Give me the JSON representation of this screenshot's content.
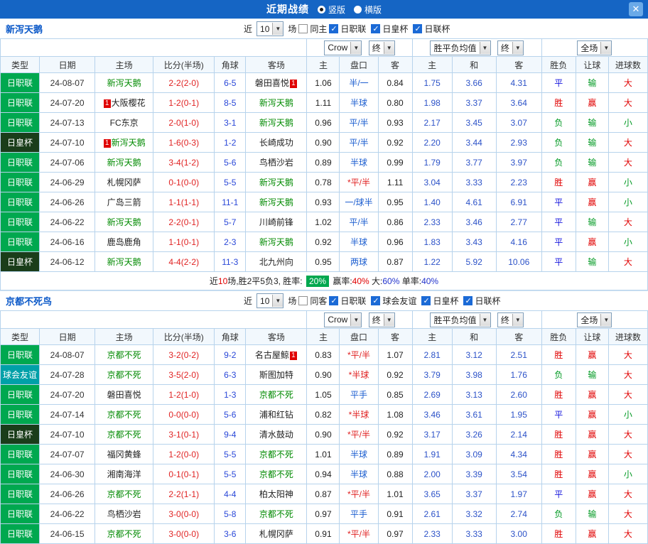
{
  "title_bar": {
    "title": "近期战绩",
    "vertical": "竖版",
    "horizontal": "横版",
    "close": "✕"
  },
  "labels": {
    "near": "近",
    "games": "场",
    "badge": "1"
  },
  "selects": {
    "company": "Crow",
    "final": "终",
    "avg": "胜平负均值",
    "full": "全场"
  },
  "cols": [
    "类型",
    "日期",
    "主场",
    "比分(半场)",
    "角球",
    "客场",
    "主",
    "盘口",
    "客",
    "主",
    "和",
    "客",
    "胜负",
    "让球",
    "进球数"
  ],
  "type_colors": {
    "日职联": "#00a84f",
    "日皇杯": "#1a3d1a",
    "球会友谊": "#00a0a8"
  },
  "colors": {
    "titlebar": "#1565c4",
    "grid_border": "#b7d3ec",
    "focus_team": "#018a01",
    "score_red": "#e02222",
    "odds_blue": "#2c52c8",
    "win_red": "#e00000",
    "lose_green": "#009922",
    "draw_blue": "#1515dd"
  },
  "sections": [
    {
      "team": "新泻天鹅",
      "count": "10",
      "same": "同主",
      "leagues": [
        "日职联",
        "日皇杯",
        "日联杯"
      ],
      "rows": [
        {
          "type": "日职联",
          "date": "24-08-07",
          "home": "新泻天鹅",
          "hf": true,
          "hb": "",
          "away": "磐田喜悦",
          "af": false,
          "ab": "after",
          "score": "2-2(2-0)",
          "corner": "6-5",
          "ah": [
            "1.06",
            "半/一",
            "0.84"
          ],
          "odds": [
            "1.75",
            "3.66",
            "4.31"
          ],
          "res": "平",
          "lt": "输",
          "sz": "大"
        },
        {
          "type": "日职联",
          "date": "24-07-20",
          "home": "大阪樱花",
          "hf": false,
          "hb": "before",
          "away": "新泻天鹅",
          "af": true,
          "ab": "",
          "score": "1-2(0-1)",
          "corner": "8-5",
          "ah": [
            "1.11",
            "半球",
            "0.80"
          ],
          "odds": [
            "1.98",
            "3.37",
            "3.64"
          ],
          "res": "胜",
          "lt": "赢",
          "sz": "大"
        },
        {
          "type": "日职联",
          "date": "24-07-13",
          "home": "FC东京",
          "hf": false,
          "hb": "",
          "away": "新泻天鹅",
          "af": true,
          "ab": "",
          "score": "2-0(1-0)",
          "corner": "3-1",
          "ah": [
            "0.96",
            "平/半",
            "0.93"
          ],
          "odds": [
            "2.17",
            "3.45",
            "3.07"
          ],
          "res": "负",
          "lt": "输",
          "sz": "小"
        },
        {
          "type": "日皇杯",
          "date": "24-07-10",
          "home": "新泻天鹅",
          "hf": true,
          "hb": "before",
          "away": "长崎成功",
          "af": false,
          "ab": "",
          "score": "1-6(0-3)",
          "corner": "1-2",
          "ah": [
            "0.90",
            "平/半",
            "0.92"
          ],
          "odds": [
            "2.20",
            "3.44",
            "2.93"
          ],
          "res": "负",
          "lt": "输",
          "sz": "大"
        },
        {
          "type": "日职联",
          "date": "24-07-06",
          "home": "新泻天鹅",
          "hf": true,
          "hb": "",
          "away": "鸟栖沙岩",
          "af": false,
          "ab": "",
          "score": "3-4(1-2)",
          "corner": "5-6",
          "ah": [
            "0.89",
            "半球",
            "0.99"
          ],
          "odds": [
            "1.79",
            "3.77",
            "3.97"
          ],
          "res": "负",
          "lt": "输",
          "sz": "大"
        },
        {
          "type": "日职联",
          "date": "24-06-29",
          "home": "札幌冈萨",
          "hf": false,
          "hb": "",
          "away": "新泻天鹅",
          "af": true,
          "ab": "",
          "score": "0-1(0-0)",
          "corner": "5-5",
          "ah": [
            "0.78",
            "*平/半",
            "1.11"
          ],
          "odds": [
            "3.04",
            "3.33",
            "2.23"
          ],
          "res": "胜",
          "lt": "赢",
          "sz": "小"
        },
        {
          "type": "日职联",
          "date": "24-06-26",
          "home": "广岛三箭",
          "hf": false,
          "hb": "",
          "away": "新泻天鹅",
          "af": true,
          "ab": "",
          "score": "1-1(1-1)",
          "corner": "11-1",
          "ah": [
            "0.93",
            "一/球半",
            "0.95"
          ],
          "odds": [
            "1.40",
            "4.61",
            "6.91"
          ],
          "res": "平",
          "lt": "赢",
          "sz": "小"
        },
        {
          "type": "日职联",
          "date": "24-06-22",
          "home": "新泻天鹅",
          "hf": true,
          "hb": "",
          "away": "川崎前锋",
          "af": false,
          "ab": "",
          "score": "2-2(0-1)",
          "corner": "5-7",
          "ah": [
            "1.02",
            "平/半",
            "0.86"
          ],
          "odds": [
            "2.33",
            "3.46",
            "2.77"
          ],
          "res": "平",
          "lt": "输",
          "sz": "大"
        },
        {
          "type": "日职联",
          "date": "24-06-16",
          "home": "鹿岛鹿角",
          "hf": false,
          "hb": "",
          "away": "新泻天鹅",
          "af": true,
          "ab": "",
          "score": "1-1(0-1)",
          "corner": "2-3",
          "ah": [
            "0.92",
            "半球",
            "0.96"
          ],
          "odds": [
            "1.83",
            "3.43",
            "4.16"
          ],
          "res": "平",
          "lt": "赢",
          "sz": "小"
        },
        {
          "type": "日皇杯",
          "date": "24-06-12",
          "home": "新泻天鹅",
          "hf": true,
          "hb": "",
          "away": "北九州向",
          "af": false,
          "ab": "",
          "score": "4-4(2-2)",
          "corner": "11-3",
          "ah": [
            "0.95",
            "两球",
            "0.87"
          ],
          "odds": [
            "1.22",
            "5.92",
            "10.06"
          ],
          "res": "平",
          "lt": "输",
          "sz": "大"
        }
      ],
      "summary": [
        {
          "text": "近"
        },
        {
          "text": "10",
          "cls": "sum-red"
        },
        {
          "text": "场,胜2平5负3, 胜率: "
        },
        {
          "text": "20%",
          "cls": "badge-green"
        },
        {
          "text": " 赢率:"
        },
        {
          "text": "40%",
          "cls": "sum-red"
        },
        {
          "text": " 大:"
        },
        {
          "text": "60%",
          "cls": "sum-blue"
        },
        {
          "text": " 单率:"
        },
        {
          "text": "40%",
          "cls": "sum-blue"
        }
      ]
    },
    {
      "team": "京都不死鸟",
      "count": "10",
      "same": "同客",
      "leagues": [
        "日职联",
        "球会友谊",
        "日皇杯",
        "日联杯"
      ],
      "rows": [
        {
          "type": "日职联",
          "date": "24-08-07",
          "home": "京都不死",
          "hf": true,
          "hb": "",
          "away": "名古屋鲸",
          "af": false,
          "ab": "after",
          "score": "3-2(0-2)",
          "corner": "9-2",
          "ah": [
            "0.83",
            "*平/半",
            "1.07"
          ],
          "odds": [
            "2.81",
            "3.12",
            "2.51"
          ],
          "res": "胜",
          "lt": "赢",
          "sz": "大"
        },
        {
          "type": "球会友谊",
          "date": "24-07-28",
          "home": "京都不死",
          "hf": true,
          "hb": "",
          "away": "斯图加特",
          "af": false,
          "ab": "",
          "score": "3-5(2-0)",
          "corner": "6-3",
          "ah": [
            "0.90",
            "*半球",
            "0.92"
          ],
          "odds": [
            "3.79",
            "3.98",
            "1.76"
          ],
          "res": "负",
          "lt": "输",
          "sz": "大"
        },
        {
          "type": "日职联",
          "date": "24-07-20",
          "home": "磐田喜悦",
          "hf": false,
          "hb": "",
          "away": "京都不死",
          "af": true,
          "ab": "",
          "score": "1-2(1-0)",
          "corner": "1-3",
          "ah": [
            "1.05",
            "平手",
            "0.85"
          ],
          "odds": [
            "2.69",
            "3.13",
            "2.60"
          ],
          "res": "胜",
          "lt": "赢",
          "sz": "大"
        },
        {
          "type": "日职联",
          "date": "24-07-14",
          "home": "京都不死",
          "hf": true,
          "hb": "",
          "away": "浦和红钻",
          "af": false,
          "ab": "",
          "score": "0-0(0-0)",
          "corner": "5-6",
          "ah": [
            "0.82",
            "*半球",
            "1.08"
          ],
          "odds": [
            "3.46",
            "3.61",
            "1.95"
          ],
          "res": "平",
          "lt": "赢",
          "sz": "小"
        },
        {
          "type": "日皇杯",
          "date": "24-07-10",
          "home": "京都不死",
          "hf": true,
          "hb": "",
          "away": "清水鼓动",
          "af": false,
          "ab": "",
          "score": "3-1(0-1)",
          "corner": "9-4",
          "ah": [
            "0.90",
            "*平/半",
            "0.92"
          ],
          "odds": [
            "3.17",
            "3.26",
            "2.14"
          ],
          "res": "胜",
          "lt": "赢",
          "sz": "大"
        },
        {
          "type": "日职联",
          "date": "24-07-07",
          "home": "福冈黄蜂",
          "hf": false,
          "hb": "",
          "away": "京都不死",
          "af": true,
          "ab": "",
          "score": "1-2(0-0)",
          "corner": "5-5",
          "ah": [
            "1.01",
            "半球",
            "0.89"
          ],
          "odds": [
            "1.91",
            "3.09",
            "4.34"
          ],
          "res": "胜",
          "lt": "赢",
          "sz": "大"
        },
        {
          "type": "日职联",
          "date": "24-06-30",
          "home": "湘南海洋",
          "hf": false,
          "hb": "",
          "away": "京都不死",
          "af": true,
          "ab": "",
          "score": "0-1(0-1)",
          "corner": "5-5",
          "ah": [
            "0.94",
            "半球",
            "0.88"
          ],
          "odds": [
            "2.00",
            "3.39",
            "3.54"
          ],
          "res": "胜",
          "lt": "赢",
          "sz": "小"
        },
        {
          "type": "日职联",
          "date": "24-06-26",
          "home": "京都不死",
          "hf": true,
          "hb": "",
          "away": "柏太阳神",
          "af": false,
          "ab": "",
          "score": "2-2(1-1)",
          "corner": "4-4",
          "ah": [
            "0.87",
            "*平/半",
            "1.01"
          ],
          "odds": [
            "3.65",
            "3.37",
            "1.97"
          ],
          "res": "平",
          "lt": "赢",
          "sz": "大"
        },
        {
          "type": "日职联",
          "date": "24-06-22",
          "home": "鸟栖沙岩",
          "hf": false,
          "hb": "",
          "away": "京都不死",
          "af": true,
          "ab": "",
          "score": "3-0(0-0)",
          "corner": "5-8",
          "ah": [
            "0.97",
            "平手",
            "0.91"
          ],
          "odds": [
            "2.61",
            "3.32",
            "2.74"
          ],
          "res": "负",
          "lt": "输",
          "sz": "大"
        },
        {
          "type": "日职联",
          "date": "24-06-15",
          "home": "京都不死",
          "hf": true,
          "hb": "",
          "away": "札幌冈萨",
          "af": false,
          "ab": "",
          "score": "3-0(0-0)",
          "corner": "3-6",
          "ah": [
            "0.91",
            "*平/半",
            "0.97"
          ],
          "odds": [
            "2.33",
            "3.33",
            "3.00"
          ],
          "res": "胜",
          "lt": "赢",
          "sz": "大"
        }
      ]
    }
  ]
}
